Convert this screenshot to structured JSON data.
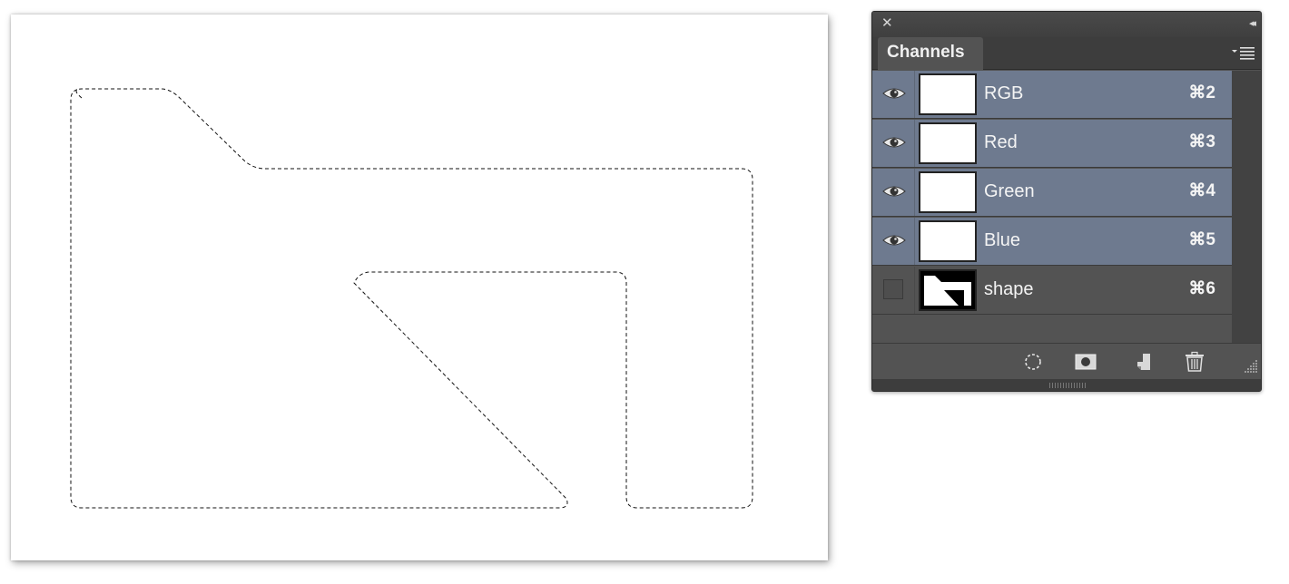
{
  "panel": {
    "close_symbol": "✕",
    "collapse_symbol": "◂◂",
    "tab_label": "Channels",
    "menu_icon": "panel-menu-icon"
  },
  "channels": [
    {
      "name": "RGB",
      "shortcut": "⌘2",
      "visible": true,
      "selected": true,
      "thumbnail": "white"
    },
    {
      "name": "Red",
      "shortcut": "⌘3",
      "visible": true,
      "selected": true,
      "thumbnail": "white"
    },
    {
      "name": "Green",
      "shortcut": "⌘4",
      "visible": true,
      "selected": true,
      "thumbnail": "white"
    },
    {
      "name": "Blue",
      "shortcut": "⌘5",
      "visible": true,
      "selected": true,
      "thumbnail": "white"
    },
    {
      "name": "shape",
      "shortcut": "⌘6",
      "visible": false,
      "selected": false,
      "thumbnail": "folder-mask"
    }
  ],
  "footer_buttons": [
    "load-selection-icon",
    "save-selection-icon",
    "new-channel-icon",
    "trash-icon"
  ],
  "colors": {
    "panel_bg": "#535353",
    "selected_row": "#6e7a8f",
    "titlebar": "#3f3f3f"
  }
}
